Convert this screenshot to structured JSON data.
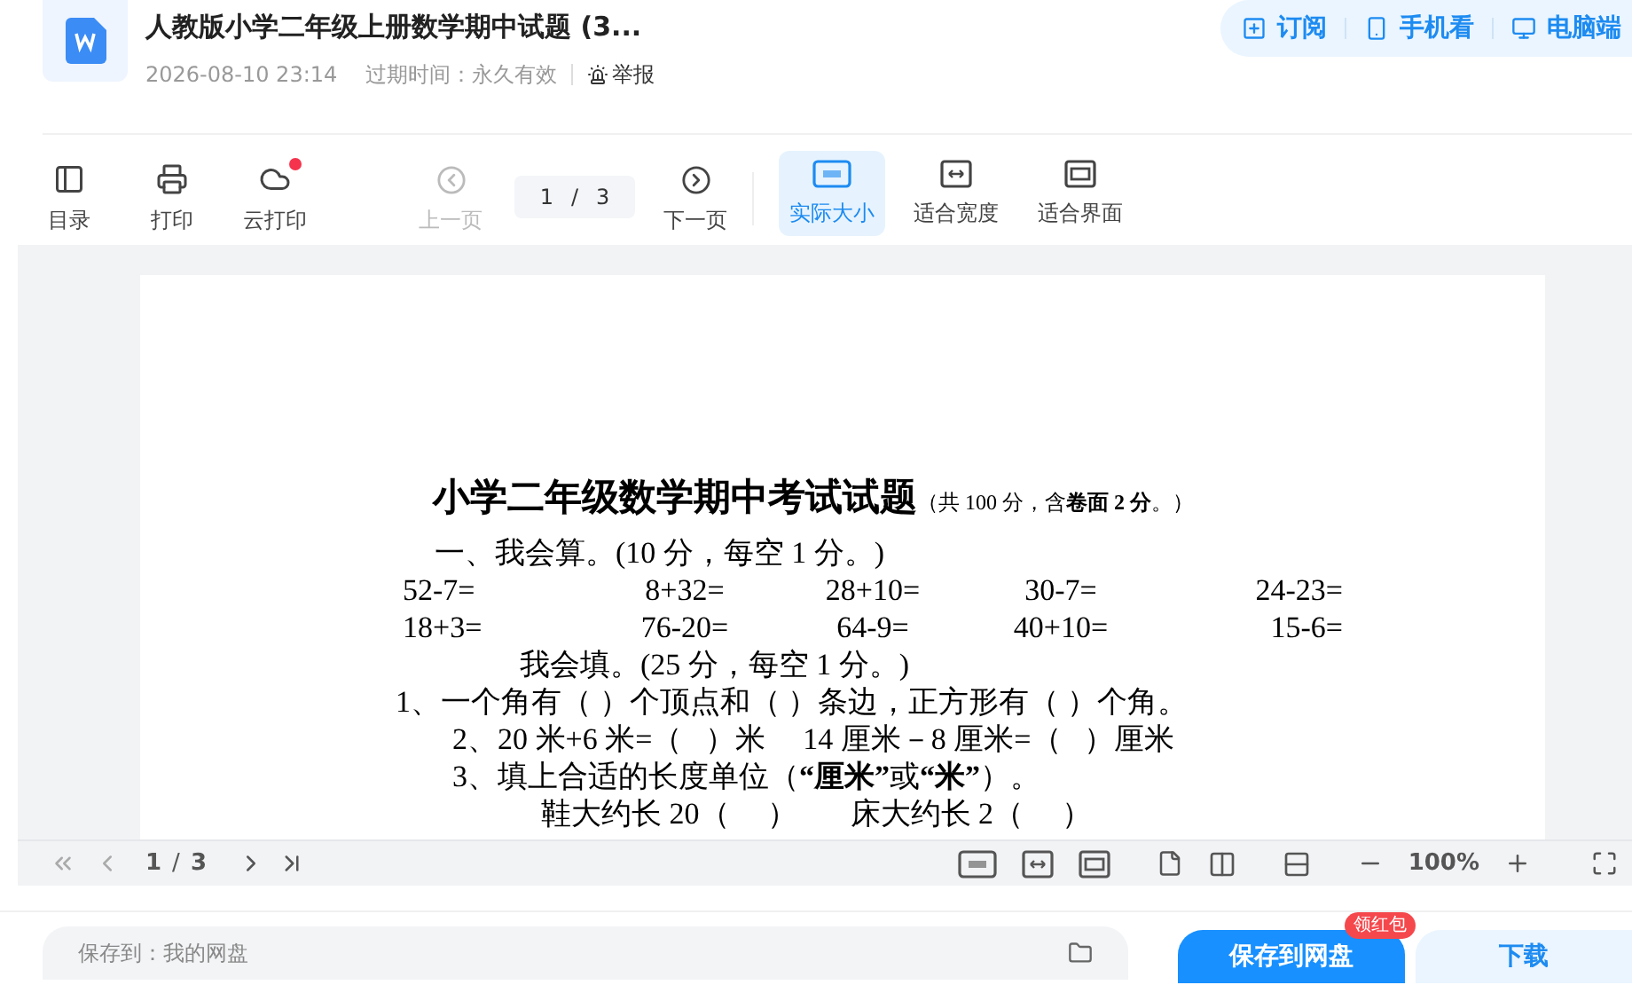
{
  "header": {
    "title": "人教版小学二年级上册数学期中试题 (3...",
    "date": "2026-08-10 23:14",
    "expiry": "过期时间：永久有效",
    "report": "举报",
    "actions": [
      {
        "kind": "subscribe",
        "label": "订阅"
      },
      {
        "kind": "mobile",
        "label": "手机看"
      },
      {
        "kind": "desktop",
        "label": "电脑端"
      }
    ]
  },
  "toolbar": {
    "tools": [
      {
        "kind": "toc",
        "label": "目录",
        "dot": false
      },
      {
        "kind": "print",
        "label": "打印",
        "dot": false
      },
      {
        "kind": "cloud",
        "label": "云打印",
        "dot": true
      }
    ],
    "prev": {
      "label": "上一页",
      "disabled": true
    },
    "page": {
      "current": "1",
      "sep": "/",
      "total": "3"
    },
    "next": {
      "label": "下一页",
      "disabled": false
    },
    "views": [
      {
        "kind": "actual",
        "label": "实际大小",
        "selected": true
      },
      {
        "kind": "width",
        "label": "适合宽度",
        "selected": false
      },
      {
        "kind": "fit",
        "label": "适合界面",
        "selected": false
      }
    ]
  },
  "document": {
    "title": "小学二年级数学期中考试试题",
    "title_note": "（共 100 分，含**卷面 2 分**。）",
    "lines": [
      {
        "kind": "section",
        "text": "一、我会算。(10 分，每空 1 分。)"
      },
      {
        "kind": "equations",
        "cells": [
          "52-7=",
          "8+32=",
          "28+10=",
          "30-7=",
          "24-23="
        ]
      },
      {
        "kind": "equations",
        "cells": [
          "18+3=",
          "76-20=",
          "64-9=",
          "40+10=",
          "15-6="
        ]
      },
      {
        "kind": "section2",
        "text": "我会填。(25 分，每空 1 分。)"
      },
      {
        "kind": "item",
        "text": "1、一个角有（  ）个顶点和（  ）条边，正方形有（  ）个角。"
      },
      {
        "kind": "sub",
        "text": "2、20 米+6 米=（   ）米     14 厘米－8 厘米=（   ）厘米"
      },
      {
        "kind": "sub",
        "text": "3、填上合适的长度单位（**“厘米”**或**“米”**）。"
      },
      {
        "kind": "deep",
        "text": "鞋大约长 20（     ）       床大约长 2（     ）"
      }
    ]
  },
  "pager": {
    "current": "1",
    "sep": "/",
    "total": "3",
    "zoom": "100%"
  },
  "save_bar": {
    "target": "保存到：我的网盘",
    "save": "保存到网盘",
    "badge": "领红包",
    "download": "下载"
  }
}
